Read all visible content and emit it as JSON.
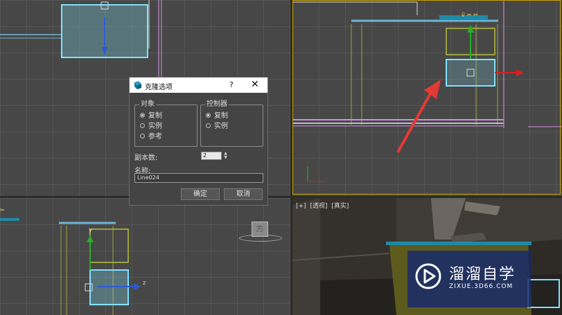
{
  "viewport_perspective": {
    "labels": [
      "[+]",
      "[透视]",
      "[真实]"
    ]
  },
  "dialog": {
    "title": "克隆选项",
    "help": "?",
    "close": "✕",
    "object_group": {
      "title": "对象",
      "options": [
        "复制",
        "实例",
        "参考"
      ],
      "selected": "复制"
    },
    "controller_group": {
      "title": "控制器",
      "options": [
        "复制",
        "实例"
      ],
      "selected": "复制"
    },
    "copies_label": "副本数:",
    "copies_value": "2",
    "name_label": "名称:",
    "name_value": "Line024",
    "ok_label": "确定",
    "cancel_label": "取消"
  },
  "viewcube_label": "方",
  "axis_labels": {
    "x": "x",
    "y": "y",
    "z": "z"
  },
  "watermark": {
    "name": "溜溜自学",
    "url": "ZIXUE.3D66.COM"
  },
  "colors": {
    "dialog_bg": "#444444",
    "selection": "#7fe3ff",
    "active_viewport_border": "#c9a200",
    "arrow_red": "#e53935"
  }
}
